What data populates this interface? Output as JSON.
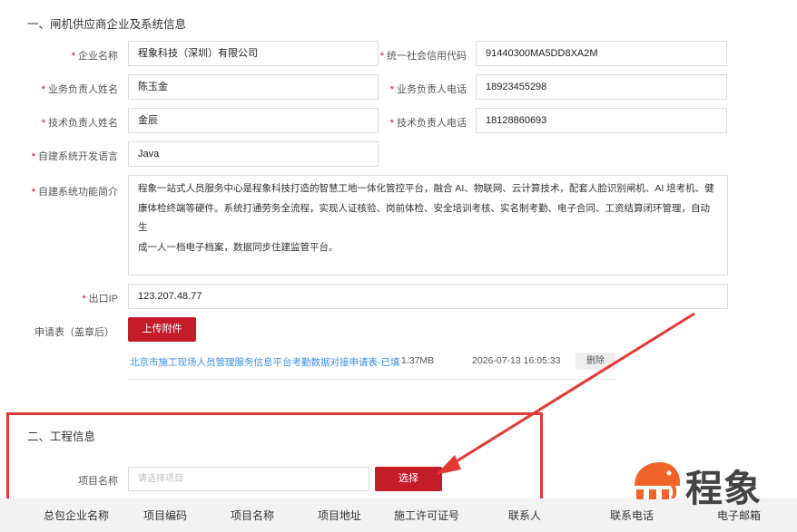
{
  "section1": {
    "title": "一、闸机供应商企业及系统信息"
  },
  "form": {
    "required_mark": "*",
    "company_name": {
      "label": "企业名称",
      "value": "程象科技（深圳）有限公司"
    },
    "credit_code": {
      "label": "统一社会信用代码",
      "value": "91440300MA5DD8XA2M"
    },
    "biz_contact_name": {
      "label": "业务负责人姓名",
      "value": "陈玉金"
    },
    "biz_contact_phone": {
      "label": "业务负责人电话",
      "value": "18923455298"
    },
    "tech_contact_name": {
      "label": "技术负责人姓名",
      "value": "金辰"
    },
    "tech_contact_phone": {
      "label": "技术负责人电话",
      "value": "18128860693"
    },
    "dev_language": {
      "label": "自建系统开发语言",
      "value": "Java"
    },
    "system_intro": {
      "label": "自建系统功能简介",
      "lines": [
        "程象一站式人员服务中心是程象科技打造的智慧工地一体化管控平台，融合 AI、物联网、云计算技术，配套人脸识别闸机、AI 培考机、健",
        "康体检终端等硬件。系统打通劳务全流程，实现人证核验、岗前体检、安全培训考核、实名制考勤、电子合同、工资结算闭环管理，自动生",
        "成一人一档电子档案，数据同步住建监管平台。"
      ]
    },
    "exit_ip": {
      "label": "出口IP",
      "value": "123.207.48.77"
    },
    "application_form": {
      "label": "申请表（盖章后）",
      "upload_button": "上传附件"
    }
  },
  "attachment": {
    "file_name": "北京市施工现场人员管理服务信息平台考勤数据对接申请表-已填",
    "file_size": "1.37MB",
    "uploaded_at": "2026-07-13 16:05:33",
    "delete_label": "删除"
  },
  "section2": {
    "title": "二、工程信息",
    "project_name_label": "项目名称",
    "project_placeholder": "请选择项目",
    "select_button": "选择"
  },
  "table": {
    "headers": [
      "总包企业名称",
      "项目编码",
      "项目名称",
      "项目地址",
      "施工许可证号",
      "联系人",
      "联系电话",
      "电子邮箱"
    ]
  },
  "logo": {
    "text": "程象"
  },
  "colors": {
    "accent": "#c41c28",
    "highlight_box": "#e53935",
    "link": "#3a8ee6",
    "logo_orange": "#f0642a"
  }
}
